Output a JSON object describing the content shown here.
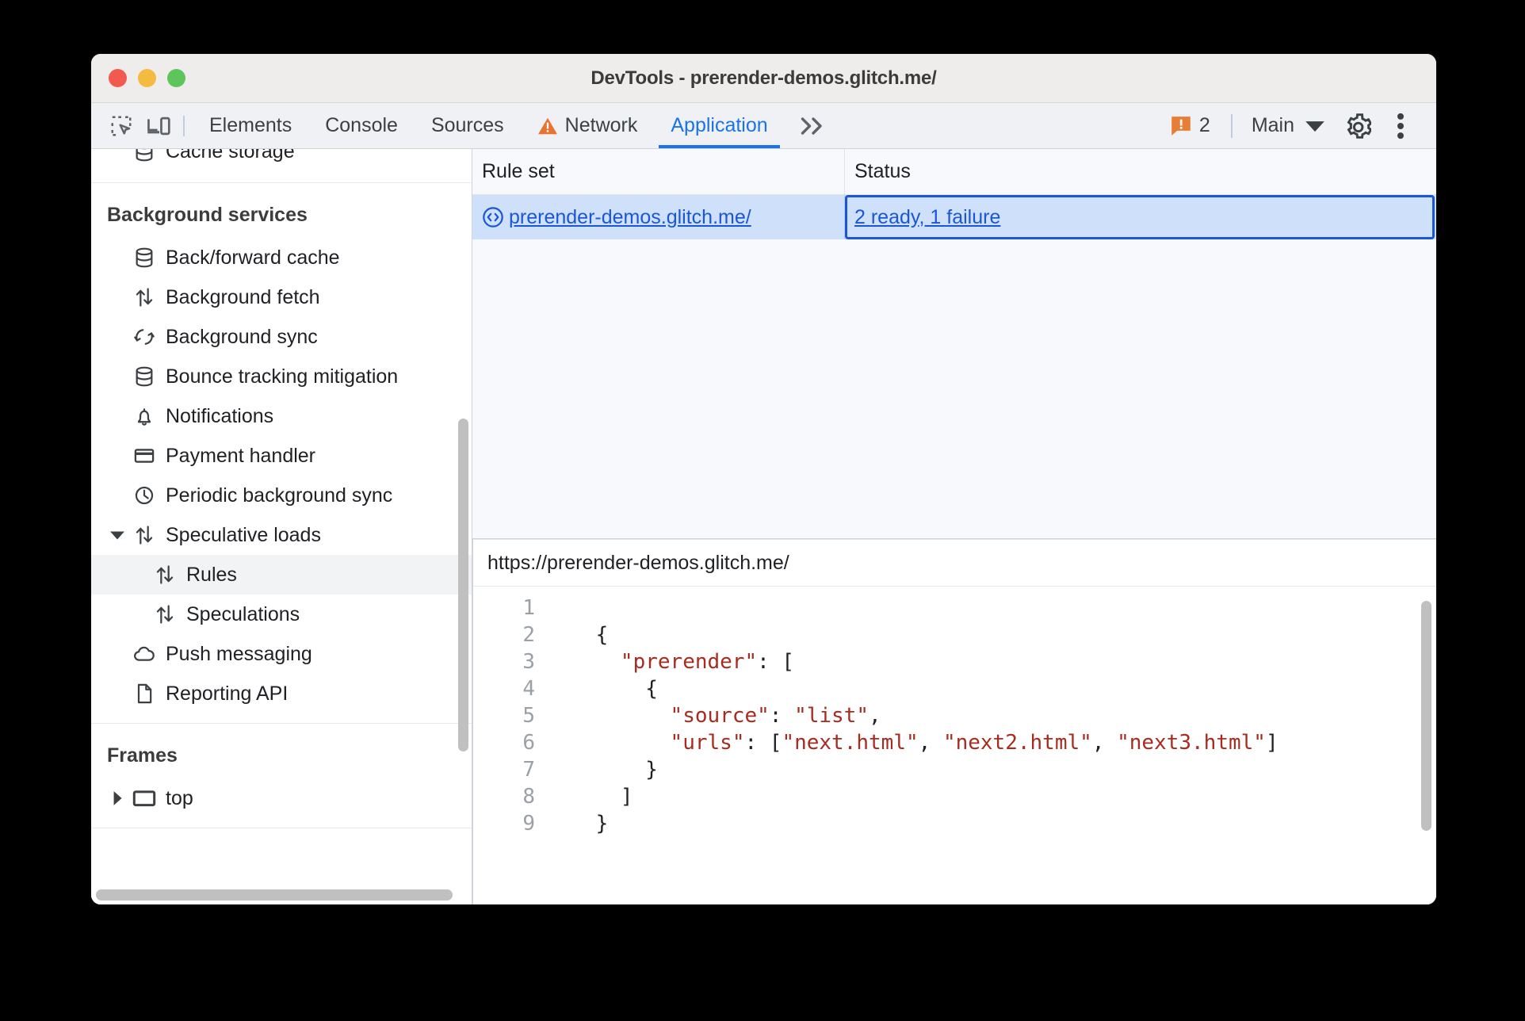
{
  "window": {
    "title": "DevTools - prerender-demos.glitch.me/",
    "traffic_lights": [
      "close",
      "minimize",
      "maximize"
    ]
  },
  "toolbar": {
    "inspect_icon": "inspect-element-icon",
    "device_icon": "device-toolbar-icon",
    "tabs": [
      {
        "label": "Elements",
        "active": false,
        "icon": null
      },
      {
        "label": "Console",
        "active": false,
        "icon": null
      },
      {
        "label": "Sources",
        "active": false,
        "icon": null
      },
      {
        "label": "Network",
        "active": false,
        "icon": "warning-triangle-icon"
      },
      {
        "label": "Application",
        "active": true,
        "icon": null
      }
    ],
    "more_tabs_label": "≫",
    "warnings": {
      "icon": "warning-badge-icon",
      "count": "2",
      "color": "#e87d36"
    },
    "context_selector": {
      "label": "Main",
      "caret": "▼"
    },
    "settings_icon": "gear-icon",
    "more_options_icon": "kebab-menu-icon",
    "accent_color": "#1a73e8"
  },
  "sidebar": {
    "clipped_top_item": {
      "label": "Cache storage",
      "icon": "database-icon"
    },
    "sections": [
      {
        "title": "Background services",
        "items": [
          {
            "label": "Back/forward cache",
            "icon": "database-icon",
            "indent": 1,
            "twisty": null,
            "selected": false
          },
          {
            "label": "Background fetch",
            "icon": "updown-arrows-icon",
            "indent": 1,
            "twisty": null,
            "selected": false
          },
          {
            "label": "Background sync",
            "icon": "sync-icon",
            "indent": 1,
            "twisty": null,
            "selected": false
          },
          {
            "label": "Bounce tracking mitigation",
            "icon": "database-icon",
            "indent": 1,
            "twisty": null,
            "selected": false
          },
          {
            "label": "Notifications",
            "icon": "bell-icon",
            "indent": 1,
            "twisty": null,
            "selected": false
          },
          {
            "label": "Payment handler",
            "icon": "credit-card-icon",
            "indent": 1,
            "twisty": null,
            "selected": false
          },
          {
            "label": "Periodic background sync",
            "icon": "clock-icon",
            "indent": 1,
            "twisty": null,
            "selected": false
          },
          {
            "label": "Speculative loads",
            "icon": "updown-arrows-icon",
            "indent": 1,
            "twisty": "expanded",
            "selected": false
          },
          {
            "label": "Rules",
            "icon": "updown-arrows-icon",
            "indent": 2,
            "twisty": null,
            "selected": true
          },
          {
            "label": "Speculations",
            "icon": "updown-arrows-icon",
            "indent": 2,
            "twisty": null,
            "selected": false
          },
          {
            "label": "Push messaging",
            "icon": "cloud-icon",
            "indent": 1,
            "twisty": null,
            "selected": false
          },
          {
            "label": "Reporting API",
            "icon": "document-icon",
            "indent": 1,
            "twisty": null,
            "selected": false
          }
        ]
      },
      {
        "title": "Frames",
        "items": [
          {
            "label": "top",
            "icon": "frame-icon",
            "indent": 1,
            "twisty": "collapsed",
            "selected": false
          }
        ]
      }
    ]
  },
  "rule_set_grid": {
    "columns": [
      "Rule set",
      "Status"
    ],
    "rows": [
      {
        "rule_set": "prerender-demos.glitch.me/",
        "rule_set_icon": "code-brackets-icon",
        "status": "2 ready, 1 failure",
        "selected": true,
        "status_focused": true
      }
    ]
  },
  "detail": {
    "url": "https://prerender-demos.glitch.me/",
    "code_lines": [
      {
        "num": "1",
        "segments": []
      },
      {
        "num": "2",
        "segments": [
          {
            "t": "    {",
            "k": "plain"
          }
        ]
      },
      {
        "num": "3",
        "segments": [
          {
            "t": "      ",
            "k": "plain"
          },
          {
            "t": "\"prerender\"",
            "k": "string"
          },
          {
            "t": ": [",
            "k": "plain"
          }
        ]
      },
      {
        "num": "4",
        "segments": [
          {
            "t": "        {",
            "k": "plain"
          }
        ]
      },
      {
        "num": "5",
        "segments": [
          {
            "t": "          ",
            "k": "plain"
          },
          {
            "t": "\"source\"",
            "k": "string"
          },
          {
            "t": ": ",
            "k": "plain"
          },
          {
            "t": "\"list\"",
            "k": "string"
          },
          {
            "t": ",",
            "k": "plain"
          }
        ]
      },
      {
        "num": "6",
        "segments": [
          {
            "t": "          ",
            "k": "plain"
          },
          {
            "t": "\"urls\"",
            "k": "string"
          },
          {
            "t": ": [",
            "k": "plain"
          },
          {
            "t": "\"next.html\"",
            "k": "string"
          },
          {
            "t": ", ",
            "k": "plain"
          },
          {
            "t": "\"next2.html\"",
            "k": "string"
          },
          {
            "t": ", ",
            "k": "plain"
          },
          {
            "t": "\"next3.html\"",
            "k": "string"
          },
          {
            "t": "]",
            "k": "plain"
          }
        ]
      },
      {
        "num": "7",
        "segments": [
          {
            "t": "        }",
            "k": "plain"
          }
        ]
      },
      {
        "num": "8",
        "segments": [
          {
            "t": "      ]",
            "k": "plain"
          }
        ]
      },
      {
        "num": "9",
        "segments": [
          {
            "t": "    }",
            "k": "plain"
          }
        ]
      }
    ]
  },
  "colors": {
    "string_token": "#a82b20",
    "link": "#1a56d6",
    "selection_row": "#cfe0fb",
    "warning": "#e87d36"
  }
}
